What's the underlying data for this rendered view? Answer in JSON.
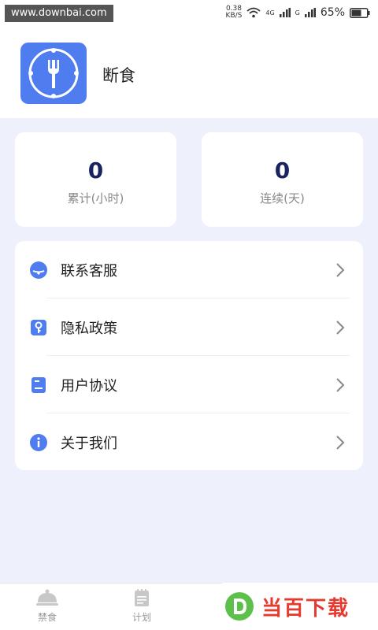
{
  "status_bar": {
    "watermark": "www.downbai.com",
    "speed_value": "0.38",
    "speed_unit": "KB/S",
    "network_1": "4G",
    "network_2": "G",
    "battery_pct": "65%",
    "battery_level": 0.65
  },
  "header": {
    "app_name": "断食",
    "logo_icon": "clock-fork-icon"
  },
  "stats": [
    {
      "value": "0",
      "label": "累计(小时)"
    },
    {
      "value": "0",
      "label": "连续(天)"
    }
  ],
  "menu": [
    {
      "label": "联系客服",
      "icon": "customer-service-icon"
    },
    {
      "label": "隐私政策",
      "icon": "key-icon"
    },
    {
      "label": "用户协议",
      "icon": "document-icon"
    },
    {
      "label": "关于我们",
      "icon": "info-icon"
    }
  ],
  "bottom_nav": [
    {
      "label": "禁食",
      "icon": "dish-cover-icon"
    },
    {
      "label": "计划",
      "icon": "notepad-icon"
    }
  ],
  "brand_badge": {
    "text": "当百下载"
  },
  "colors": {
    "accent": "#4f7df0",
    "background": "#eef1fb",
    "stat_value": "#1a2360",
    "brand": "#e63a2e"
  }
}
